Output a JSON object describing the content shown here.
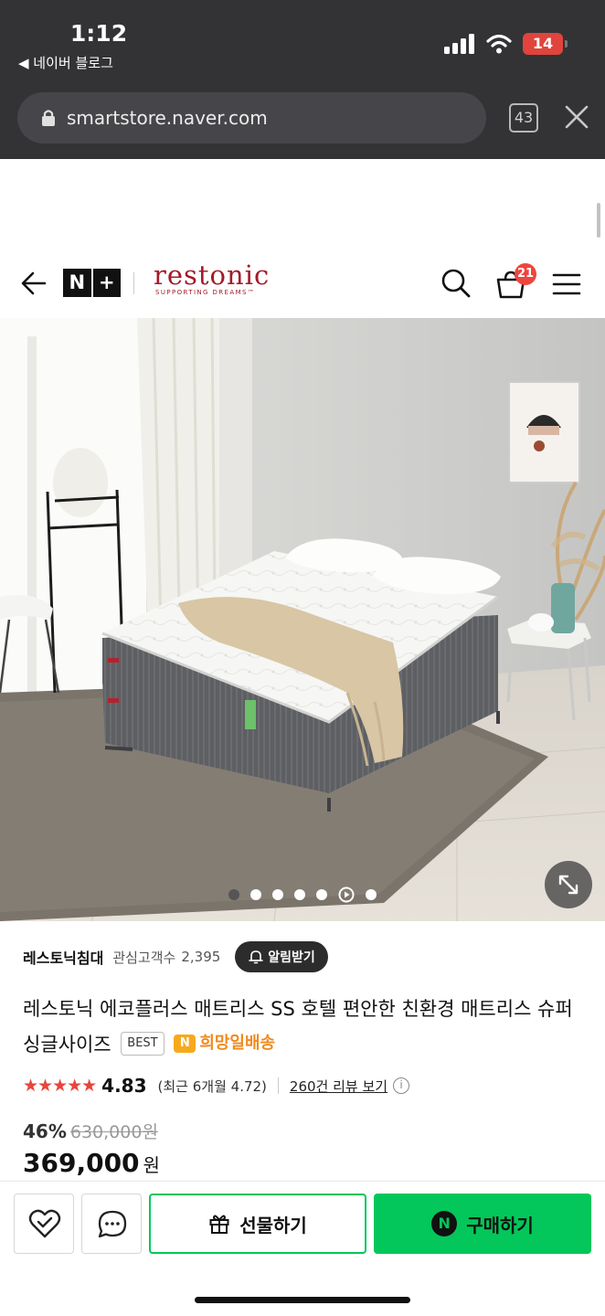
{
  "status_bar": {
    "time": "1:12",
    "back_app": "◀ 네이버 블로그",
    "battery": "14"
  },
  "browser": {
    "url": "smartstore.naver.com",
    "tab_count": "43"
  },
  "header": {
    "nplus_left": "N",
    "nplus_right": "+",
    "logo_main": "restonic",
    "logo_sub": "SUPPORTING DREAMS™",
    "cart_count": "21"
  },
  "gallery": {
    "slide_count": 7,
    "active_index": 0,
    "video_index": 5
  },
  "store": {
    "name": "레스토닉침대",
    "fav_label": "관심고객수",
    "fav_count": "2,395",
    "alert_label": "알림받기"
  },
  "product": {
    "title": "레스토닉 에코플러스 매트리스 SS 호텔 편안한 친환경 매트리스 슈퍼싱글사이즈",
    "best_badge": "BEST",
    "delivery_label": "희망일배송",
    "delivery_icon": "N"
  },
  "rating": {
    "stars": "★★★★★",
    "value": "4.83",
    "recent": "(최근 6개월 4.72)",
    "review_link": "260건 리뷰 보기",
    "info": "i"
  },
  "price": {
    "discount": "46%",
    "original": "630,000원",
    "current": "369,000",
    "unit": "원"
  },
  "actions": {
    "gift_label": "선물하기",
    "buy_label": "구매하기",
    "buy_icon": "N"
  },
  "colors": {
    "naver_green": "#03c75a",
    "brand_red": "#a31b2a",
    "star_red": "#e8453c",
    "delivery_orange": "#f08a1e"
  }
}
